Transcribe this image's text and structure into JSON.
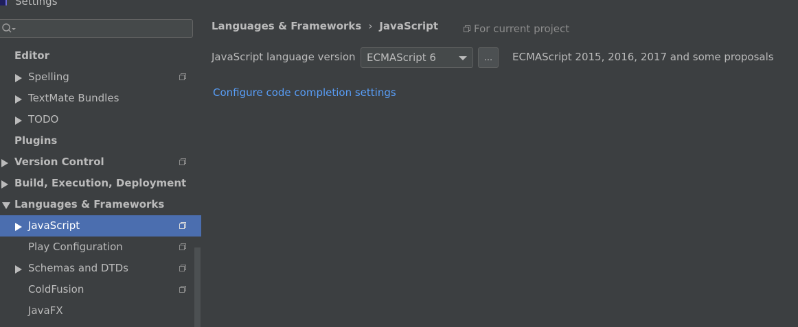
{
  "window": {
    "title": "Settings"
  },
  "search": {
    "placeholder": "",
    "value": ""
  },
  "sidebar": {
    "items": [
      {
        "label": "Editor",
        "bold": true,
        "indent": 21,
        "arrow": "none",
        "project_icon": false
      },
      {
        "label": "Spelling",
        "bold": false,
        "indent": 41,
        "arrow": "right",
        "project_icon": true
      },
      {
        "label": "TextMate Bundles",
        "bold": false,
        "indent": 41,
        "arrow": "right",
        "project_icon": false
      },
      {
        "label": "TODO",
        "bold": false,
        "indent": 41,
        "arrow": "right",
        "project_icon": false
      },
      {
        "label": "Plugins",
        "bold": true,
        "indent": 21,
        "arrow": "none",
        "project_icon": false
      },
      {
        "label": "Version Control",
        "bold": true,
        "indent": 21,
        "arrow": "right",
        "project_icon": true
      },
      {
        "label": "Build, Execution, Deployment",
        "bold": true,
        "indent": 21,
        "arrow": "right",
        "project_icon": false
      },
      {
        "label": "Languages & Frameworks",
        "bold": true,
        "indent": 21,
        "arrow": "down",
        "project_icon": false
      },
      {
        "label": "JavaScript",
        "bold": false,
        "indent": 41,
        "arrow": "right",
        "project_icon": true,
        "selected": true
      },
      {
        "label": "Play Configuration",
        "bold": false,
        "indent": 41,
        "arrow": "none",
        "project_icon": true
      },
      {
        "label": "Schemas and DTDs",
        "bold": false,
        "indent": 41,
        "arrow": "right",
        "project_icon": true
      },
      {
        "label": "ColdFusion",
        "bold": false,
        "indent": 41,
        "arrow": "none",
        "project_icon": true
      },
      {
        "label": "JavaFX",
        "bold": false,
        "indent": 41,
        "arrow": "none",
        "project_icon": false
      }
    ]
  },
  "main": {
    "breadcrumb": {
      "parent": "Languages & Frameworks",
      "separator": "›",
      "current": "JavaScript"
    },
    "scope": "For current project",
    "language_version_label": "JavaScript language version",
    "language_version": "ECMAScript 6",
    "more_button_label": "...",
    "version_description": "ECMAScript 2015, 2016, 2017 and some proposals",
    "config_link": "Configure code completion settings"
  },
  "colors": {
    "background": "#3c3f41",
    "selection": "#4b6eaf",
    "link": "#589df6",
    "text": "#bbbbbb"
  }
}
